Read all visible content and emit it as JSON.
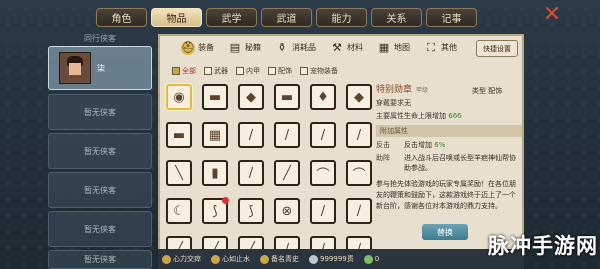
{
  "tabs": [
    {
      "label": "角色",
      "active": false
    },
    {
      "label": "物品",
      "active": true
    },
    {
      "label": "武学",
      "active": false
    },
    {
      "label": "武道",
      "active": false
    },
    {
      "label": "能力",
      "active": false
    },
    {
      "label": "关系",
      "active": false
    },
    {
      "label": "记事",
      "active": false
    }
  ],
  "left": {
    "header": "同行侠客",
    "active_name": "柒",
    "empty_label": "暂无侠客",
    "slots": [
      "暂无侠客",
      "暂无侠客",
      "暂无侠客",
      "暂无侠客",
      "暂无侠客"
    ]
  },
  "categories": [
    {
      "label": "装备",
      "icon": "helmet-icon"
    },
    {
      "label": "秘籍",
      "icon": "book-icon"
    },
    {
      "label": "消耗品",
      "icon": "potion-icon"
    },
    {
      "label": "材料",
      "icon": "material-icon"
    },
    {
      "label": "地图",
      "icon": "map-icon"
    },
    {
      "label": "其他",
      "icon": "misc-icon"
    }
  ],
  "quick_settings": "快捷设置",
  "filters": [
    "全部",
    "武器",
    "内甲",
    "配饰",
    "宠物装备"
  ],
  "grid_glyphs": [
    "◉",
    "▬",
    "◆",
    "▬",
    "♦",
    "◆",
    "▬",
    "▦",
    "/",
    "/",
    "/",
    "/",
    "╲",
    "▮",
    "/",
    "╱",
    "⌒",
    "⌒",
    "☾",
    "⟆",
    "⟆",
    "⊗",
    "/",
    "/",
    "╱",
    "╱",
    "╱",
    "/",
    "/",
    "/"
  ],
  "detail": {
    "name": "特别勋章",
    "quality": "甲级",
    "type_label": "类型",
    "type_value": "配饰",
    "req_label": "穿戴要求",
    "req_value": "无",
    "main_label": "主要属性",
    "main_value": "生命上限增加",
    "main_num": "666",
    "extra_section": "附加属性",
    "counter_label": "反击",
    "counter_value": "反击增加",
    "counter_num": "6%",
    "assist_label": "助阵",
    "assist_value": "进入战斗后召唤或长型羊疤神仙帮协助参战。",
    "description": "参与抢先体验游戏的玩家专属奖励！在各位朋友的鞭策和鼓励下，这款游戏终于迈上了一个新台阶，感谢各位对本游戏的鼎力支持。"
  },
  "equip_button": "替换",
  "footer": [
    {
      "icon": "coin-icon",
      "label": "心力交瘁"
    },
    {
      "icon": "coin-icon",
      "label": "心如止水"
    },
    {
      "icon": "coin-icon",
      "label": "备名青史"
    },
    {
      "icon": "silver-icon",
      "label": "999999贯"
    },
    {
      "icon": "green-icon",
      "label": "0"
    }
  ],
  "watermark": "脉冲手游网"
}
